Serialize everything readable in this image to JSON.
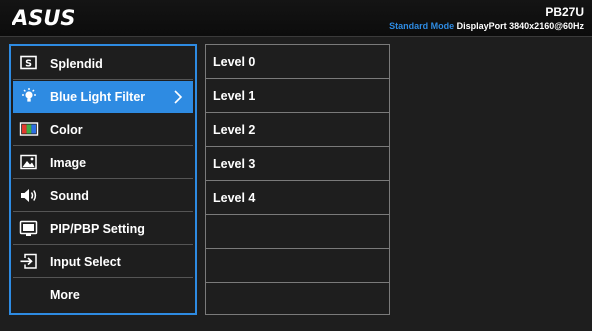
{
  "header": {
    "logo_text": "ASUS",
    "model": "PB27U",
    "mode": "Standard Mode",
    "input": "DisplayPort",
    "resolution": "3840x2160@60Hz"
  },
  "colors": {
    "accent": "#2e8be2",
    "background": "#1e1e1e",
    "text": "#ffffff"
  },
  "main_menu": {
    "items": [
      {
        "label": "Splendid",
        "icon": "splendid-icon"
      },
      {
        "label": "Blue Light Filter",
        "icon": "blue-light-icon",
        "selected": true
      },
      {
        "label": "Color",
        "icon": "color-icon"
      },
      {
        "label": "Image",
        "icon": "image-icon"
      },
      {
        "label": "Sound",
        "icon": "speaker-icon"
      },
      {
        "label": "PIP/PBP Setting",
        "icon": "pip-icon"
      },
      {
        "label": "Input Select",
        "icon": "input-select-icon"
      },
      {
        "label": "More",
        "icon": ""
      }
    ]
  },
  "sub_menu": {
    "items": [
      {
        "label": "Level 0"
      },
      {
        "label": "Level 1"
      },
      {
        "label": "Level 2"
      },
      {
        "label": "Level 3"
      },
      {
        "label": "Level 4"
      },
      {
        "label": ""
      },
      {
        "label": ""
      },
      {
        "label": ""
      }
    ]
  }
}
